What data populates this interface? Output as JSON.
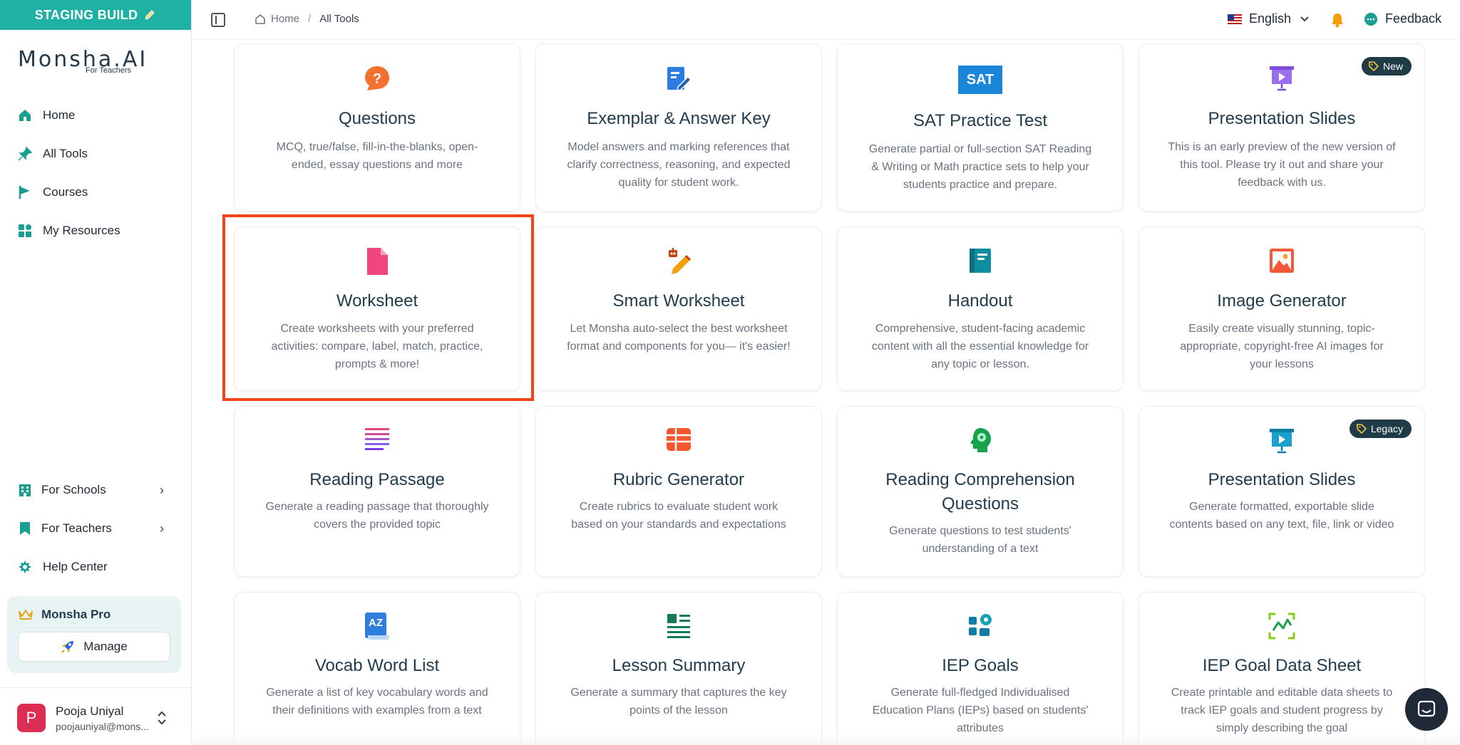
{
  "staging_banner": "STAGING BUILD",
  "logo": {
    "brand": "Monsha.AI",
    "sub": "For Teachers"
  },
  "sidebar": {
    "nav": [
      {
        "label": "Home",
        "icon": "home-icon"
      },
      {
        "label": "All Tools",
        "icon": "pin-icon"
      },
      {
        "label": "Courses",
        "icon": "flag-icon"
      },
      {
        "label": "My Resources",
        "icon": "resources-icon"
      }
    ],
    "bottom_nav": [
      {
        "label": "For Schools",
        "icon": "building-icon"
      },
      {
        "label": "For Teachers",
        "icon": "bookmark-icon"
      },
      {
        "label": "Help Center",
        "icon": "help-icon"
      }
    ],
    "pro": {
      "title": "Monsha Pro",
      "manage_label": "Manage"
    },
    "user": {
      "initial": "P",
      "name": "Pooja Uniyal",
      "email": "poojauniyal@mons..."
    }
  },
  "header": {
    "breadcrumb": {
      "home": "Home",
      "current": "All Tools"
    },
    "language": "English",
    "feedback_label": "Feedback"
  },
  "colors": {
    "accent": "#1fb2a4",
    "highlight": "#f2431c",
    "badge_bg": "#1f3b46"
  },
  "tools": [
    {
      "title": "Questions",
      "desc": "MCQ, true/false, fill-in-the-blanks, open-ended, essay questions and more",
      "icon": "question-bubble-icon"
    },
    {
      "title": "Exemplar & Answer Key",
      "desc": "Model answers and marking references that clarify correctness, reasoning, and expected quality for student work.",
      "icon": "document-edit-icon"
    },
    {
      "title": "SAT Practice Test",
      "desc": "Generate partial or full-section SAT Reading & Writing or Math practice sets to help your students practice and prepare.",
      "icon": "sat-icon",
      "icon_text": "SAT"
    },
    {
      "title": "Presentation Slides",
      "desc": "This is an early preview of the new version of this tool. Please try it out and share your feedback with us.",
      "icon": "presentation-icon",
      "badge": "New"
    },
    {
      "title": "Worksheet",
      "desc": "Create worksheets with your preferred activities: compare, label, match, practice, prompts & more!",
      "icon": "worksheet-file-icon"
    },
    {
      "title": "Smart Worksheet",
      "desc": "Let Monsha auto-select the best worksheet format and components for you— it's easier!",
      "icon": "robot-pencil-icon"
    },
    {
      "title": "Handout",
      "desc": "Comprehensive, student-facing academic content with all the essential knowledge for any topic or lesson.",
      "icon": "notebook-icon"
    },
    {
      "title": "Image Generator",
      "desc": "Easily create visually stunning, topic-appropriate, copyright-free AI images for your lessons",
      "icon": "image-icon"
    },
    {
      "title": "Reading Passage",
      "desc": "Generate a reading passage that thoroughly covers the provided topic",
      "icon": "text-lines-icon"
    },
    {
      "title": "Rubric Generator",
      "desc": "Create rubrics to evaluate student work based on your standards and expectations",
      "icon": "table-grid-icon"
    },
    {
      "title": "Reading Comprehension Questions",
      "desc": "Generate questions to test students' understanding of a text",
      "icon": "brain-head-icon"
    },
    {
      "title": "Presentation Slides",
      "desc": "Generate formatted, exportable slide contents based on any text, file, link or video",
      "icon": "presentation-play-icon",
      "badge": "Legacy"
    },
    {
      "title": "Vocab Word List",
      "desc": "Generate a list of key vocabulary words and their definitions with examples from a text",
      "icon": "az-book-icon",
      "icon_text": "AZ"
    },
    {
      "title": "Lesson Summary",
      "desc": "Generate a summary that captures the key points of the lesson",
      "icon": "summary-list-icon"
    },
    {
      "title": "IEP Goals",
      "desc": "Generate full-fledged Individualised Education Plans (IEPs) based on students' attributes",
      "icon": "puzzle-goal-icon"
    },
    {
      "title": "IEP Goal Data Sheet",
      "desc": "Create printable and editable data sheets to track IEP goals and student progress by simply describing the goal",
      "icon": "chart-frame-icon"
    }
  ]
}
